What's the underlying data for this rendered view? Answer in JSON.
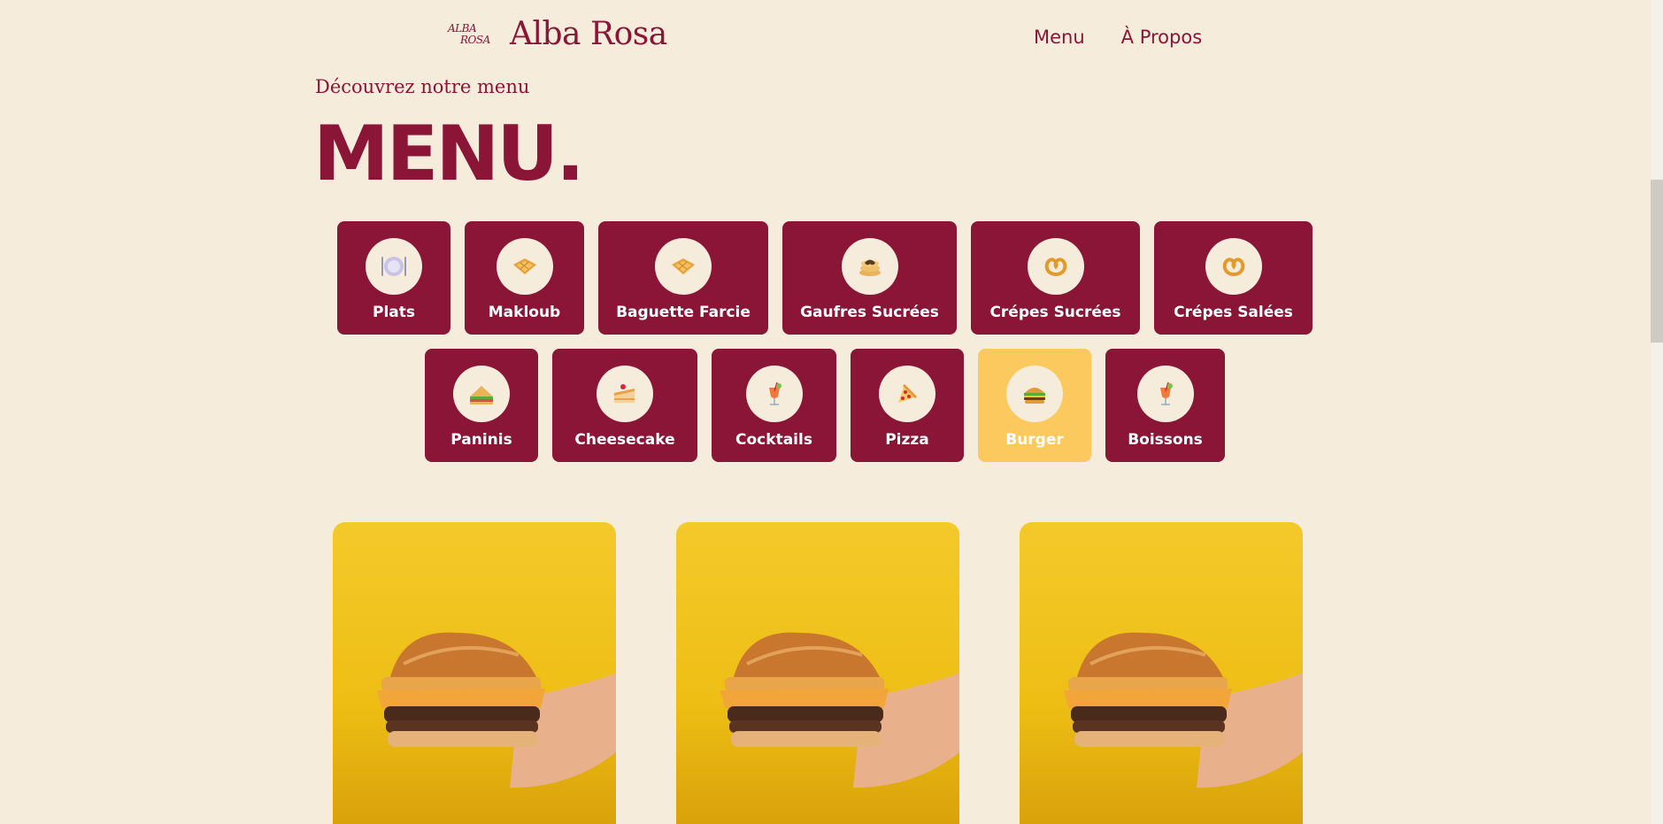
{
  "header": {
    "logo_mark_line1": "ALBA",
    "logo_mark_line2": "ROSA",
    "brand": "Alba Rosa",
    "nav": [
      "Menu",
      "À Propos"
    ]
  },
  "hero": {
    "subtitle": "Découvrez notre menu",
    "title": "MENU."
  },
  "categories": [
    {
      "label": "Plats",
      "icon": "plate-icon"
    },
    {
      "label": "Makloub",
      "icon": "waffle-icon"
    },
    {
      "label": "Baguette Farcie",
      "icon": "waffle-icon"
    },
    {
      "label": "Gaufres Sucrées",
      "icon": "pancakes-icon"
    },
    {
      "label": "Crépes Sucrées",
      "icon": "pretzel-icon"
    },
    {
      "label": "Crépes Salées",
      "icon": "pretzel-icon"
    },
    {
      "label": "Paninis",
      "icon": "sandwich-icon"
    },
    {
      "label": "Cheesecake",
      "icon": "cake-icon"
    },
    {
      "label": "Cocktails",
      "icon": "cocktail-icon"
    },
    {
      "label": "Pizza",
      "icon": "pizza-icon"
    },
    {
      "label": "Burger",
      "icon": "burger-icon",
      "active": true
    },
    {
      "label": "Boissons",
      "icon": "cocktail-icon"
    }
  ],
  "colors": {
    "background": "#f5ecdc",
    "brand": "#8a1536",
    "active": "#fbc95e",
    "product_bg": "#f4c92a"
  },
  "products": [
    {
      "image": "burger-photo"
    },
    {
      "image": "burger-photo"
    },
    {
      "image": "burger-photo"
    }
  ]
}
